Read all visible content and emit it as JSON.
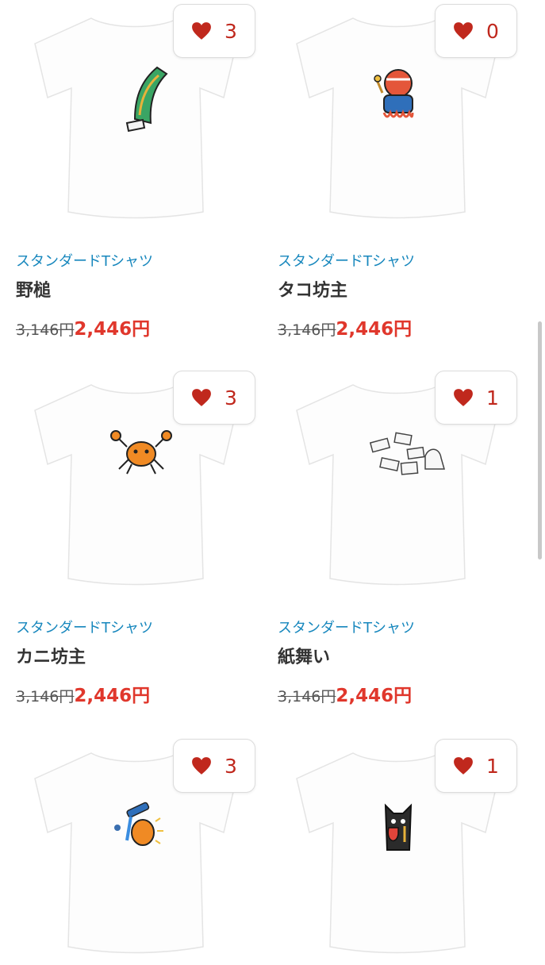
{
  "products": [
    {
      "category": "スタンダードTシャツ",
      "title": "野槌",
      "old_price": "3,146円",
      "new_price": "2,446円",
      "likes": "3",
      "design": "nozuchi-graphic"
    },
    {
      "category": "スタンダードTシャツ",
      "title": "タコ坊主",
      "old_price": "3,146円",
      "new_price": "2,446円",
      "likes": "0",
      "design": "octopus-monk-graphic"
    },
    {
      "category": "スタンダードTシャツ",
      "title": "カニ坊主",
      "old_price": "3,146円",
      "new_price": "2,446円",
      "likes": "3",
      "design": "crab-monk-graphic"
    },
    {
      "category": "スタンダードTシャツ",
      "title": "紙舞い",
      "old_price": "3,146円",
      "new_price": "2,446円",
      "likes": "1",
      "design": "dancing-paper-graphic"
    },
    {
      "likes": "3",
      "design": "pouring-creature-graphic"
    },
    {
      "likes": "1",
      "design": "tongue-creature-graphic"
    }
  ],
  "colors": {
    "accent_blue": "#1787bd",
    "sale_red": "#e0372c",
    "heart_red": "#c0281d"
  },
  "icons": {
    "like": "heart-icon"
  }
}
